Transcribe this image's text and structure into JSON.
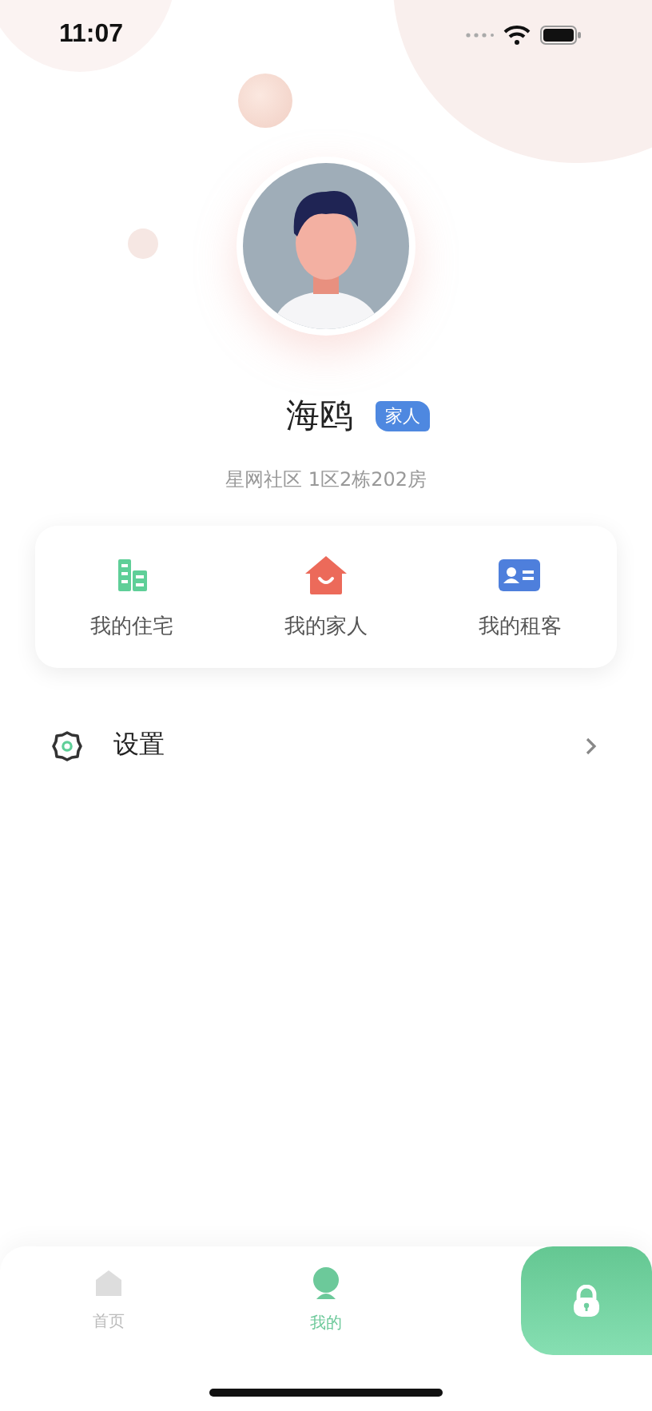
{
  "status_bar": {
    "time": "11:07"
  },
  "profile": {
    "name": "海鸥",
    "role": "家人",
    "address": "星网社区 1区2栋202房"
  },
  "shortcuts": [
    {
      "label": "我的住宅",
      "kind": "building"
    },
    {
      "label": "我的家人",
      "kind": "house"
    },
    {
      "label": "我的租客",
      "kind": "card"
    }
  ],
  "menu": [
    {
      "label": "设置",
      "kind": "settings"
    }
  ],
  "tabs": [
    {
      "label": "首页",
      "kind": "home",
      "selected": false
    },
    {
      "label": "我的",
      "kind": "person",
      "selected": true
    }
  ],
  "unlock_button": {
    "kind": "lock"
  }
}
